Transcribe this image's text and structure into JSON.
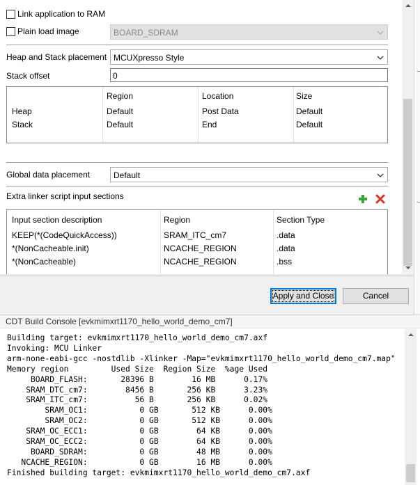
{
  "settings": {
    "link_to_ram": {
      "label": "Link application to RAM",
      "checked": false
    },
    "plain_load_image": {
      "label": "Plain load image",
      "checked": false,
      "value": "BOARD_SDRAM"
    },
    "heap_stack_placement": {
      "label": "Heap and Stack placement",
      "value": "MCUXpresso Style"
    },
    "stack_offset": {
      "label": "Stack offset",
      "value": "0"
    },
    "global_data_placement": {
      "label": "Global data placement",
      "value": "Default"
    },
    "extra_sections_label": "Extra linker script input sections"
  },
  "heap_stack_table": {
    "columns": [
      "",
      "Region",
      "Location",
      "Size"
    ],
    "rows": [
      [
        "Heap",
        "Default",
        "Post Data",
        "Default"
      ],
      [
        "Stack",
        "Default",
        "End",
        "Default"
      ]
    ]
  },
  "sections_table": {
    "columns": [
      "Input section description",
      "Region",
      "Section Type"
    ],
    "rows": [
      [
        "KEEP(*(CodeQuickAccess))",
        "SRAM_ITC_cm7",
        ".data"
      ],
      [
        "*(NonCacheable.init)",
        "NCACHE_REGION",
        ".data"
      ],
      [
        "*(NonCacheable)",
        "NCACHE_REGION",
        ".bss"
      ]
    ]
  },
  "icons": {
    "add": "plus-icon",
    "remove": "delete-icon",
    "dropdown": "chevron-down-icon"
  },
  "colors": {
    "accent": "#0078d7",
    "add_green": "#3aa43a",
    "remove_red": "#d9342b"
  },
  "buttons": {
    "apply_close": "Apply and Close",
    "cancel": "Cancel"
  },
  "console": {
    "title": "CDT Build Console [evkmimxrt1170_hello_world_demo_cm7]",
    "lines": [
      "Building target: evkmimxrt1170_hello_world_demo_cm7.axf",
      "Invoking: MCU Linker",
      "arm-none-eabi-gcc -nostdlib -Xlinker -Map=\"evkmimxrt1170_hello_world_demo_cm7.map\"",
      "Memory region         Used Size  Region Size  %age Used",
      "     BOARD_FLASH:       28396 B        16 MB      0.17%",
      "    SRAM_DTC_cm7:        8456 B       256 KB      3.23%",
      "    SRAM_ITC_cm7:          56 B       256 KB      0.02%",
      "        SRAM_OC1:           0 GB       512 KB      0.00%",
      "        SRAM_OC2:           0 GB       512 KB      0.00%",
      "    SRAM_OC_ECC1:           0 GB        64 KB      0.00%",
      "    SRAM_OC_ECC2:           0 GB        64 KB      0.00%",
      "     BOARD_SDRAM:           0 GB        48 MB      0.00%",
      "   NCACHE_REGION:           0 GB        16 MB      0.00%",
      "Finished building target: evkmimxrt1170_hello_world_demo_cm7.axf"
    ]
  }
}
